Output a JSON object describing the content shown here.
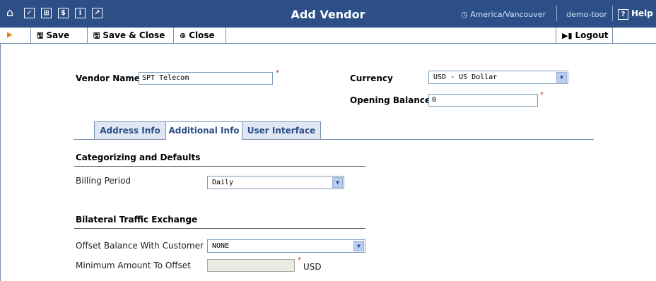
{
  "header": {
    "title": "Add Vendor",
    "timezone": "America/Vancouver",
    "user": "demo-toor",
    "help_label": "Help",
    "nav_icons": [
      "home-icon",
      "checkbox-icon",
      "grid-icon",
      "dollar-icon",
      "info-icon",
      "chart-icon"
    ]
  },
  "toolbar": {
    "save_label": "Save",
    "save_close_label": "Save & Close",
    "close_label": "Close",
    "logout_label": "Logout"
  },
  "form": {
    "vendor_name_label": "Vendor Name",
    "vendor_name_value": "SPT Telecom",
    "currency_label": "Currency",
    "currency_value": "USD - US Dollar",
    "opening_balance_label": "Opening Balance",
    "opening_balance_value": "0"
  },
  "tabs": [
    {
      "label": "Address Info",
      "active": false
    },
    {
      "label": "Additional Info",
      "active": true
    },
    {
      "label": "User Interface",
      "active": false
    }
  ],
  "sections": {
    "categorizing": {
      "title": "Categorizing and Defaults",
      "billing_period_label": "Billing Period",
      "billing_period_value": "Daily"
    },
    "bilateral": {
      "title": "Bilateral Traffic Exchange",
      "offset_label": "Offset Balance With Customer",
      "offset_value": "NONE",
      "min_amount_label": "Minimum Amount To Offset",
      "min_amount_value": "",
      "min_amount_unit": "USD"
    }
  },
  "colors": {
    "header_bg": "#2B4F86",
    "tab_text": "#2B4F86",
    "required_marker": "#e02020",
    "toolbar_arrow": "#e07c10"
  }
}
